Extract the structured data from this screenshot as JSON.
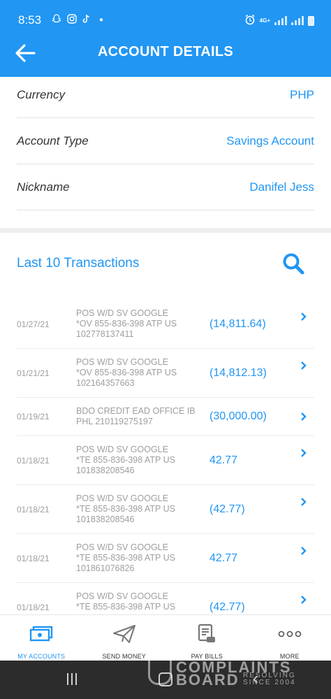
{
  "colors": {
    "brand": "#2196f3",
    "text": "#333333",
    "muted": "#9e9e9e",
    "system_bar": "#2c2c2c"
  },
  "status_bar": {
    "time": "8:53",
    "network": "4G+",
    "icons": [
      "alarm-icon",
      "signal-icon",
      "battery-icon"
    ]
  },
  "header": {
    "title": "ACCOUNT DETAILS",
    "back_icon": "arrow-left-icon"
  },
  "details": [
    {
      "label": "Currency",
      "value": "PHP"
    },
    {
      "label": "Account Type",
      "value": "Savings Account"
    },
    {
      "label": "Nickname",
      "value": "Danifel Jess"
    }
  ],
  "transactions": {
    "title": "Last 10 Transactions",
    "search_icon": "search-icon",
    "items": [
      {
        "date": "01/27/21",
        "description": "POS W/D SV GOOGLE\n*OV 855-836-398 ATP US\n102778137411",
        "amount": "(14,811.64)"
      },
      {
        "date": "01/21/21",
        "description": "POS W/D SV GOOGLE\n*OV 855-836-398 ATP US\n102164357663",
        "amount": "(14,812.13)"
      },
      {
        "date": "01/19/21",
        "description": "BDO CREDIT EAD OFFICE IB\nPHL  210119275197",
        "amount": "(30,000.00)"
      },
      {
        "date": "01/18/21",
        "description": "POS W/D SV GOOGLE\n*TE 855-836-398 ATP US\n101838208546",
        "amount": "42.77"
      },
      {
        "date": "01/18/21",
        "description": "POS W/D SV GOOGLE\n*TE 855-836-398 ATP US\n101838208546",
        "amount": "(42.77)"
      },
      {
        "date": "01/18/21",
        "description": "POS W/D SV GOOGLE\n*TE 855-836-398 ATP US\n101861076826",
        "amount": "42.77"
      },
      {
        "date": "01/18/21",
        "description": "POS W/D SV GOOGLE\n*TE 855-836-398 ATP US",
        "amount": "(42.77)"
      }
    ]
  },
  "bottom_nav": [
    {
      "label": "MY ACCOUNTS",
      "icon": "money-icon",
      "active": true
    },
    {
      "label": "SEND MONEY",
      "icon": "paper-plane-icon",
      "active": false
    },
    {
      "label": "PAY BILLS",
      "icon": "bill-icon",
      "active": false
    },
    {
      "label": "MORE",
      "icon": "more-dots-icon",
      "active": false
    }
  ],
  "watermark": {
    "line1": "COMPLAINTS",
    "line2": "BOARD",
    "line3": "RESOLVING",
    "line4": "SINCE 2004"
  }
}
